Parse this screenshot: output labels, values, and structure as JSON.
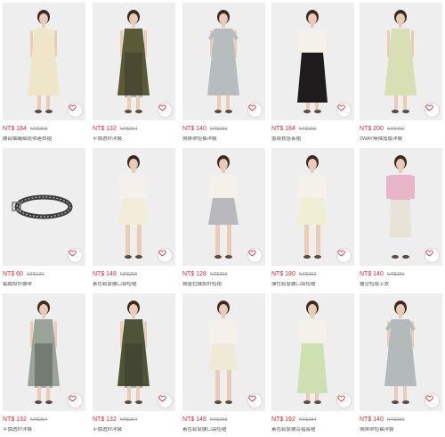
{
  "products": [
    {
      "price": "NT$ 184",
      "was": "NT$368",
      "name": "腰部抽繩細肩帶連衣裙",
      "garment": "dress",
      "color": "#efe6c8",
      "skin": "#e9cbb6"
    },
    {
      "price": "NT$ 132",
      "was": "NT$264",
      "name": "平價透紗洋裝",
      "garment": "layered",
      "color": "#5a5a36",
      "skin": "#e9cbb6"
    },
    {
      "price": "NT$ 140",
      "was": "NT$280",
      "name": "側綁帶短袖洋裝",
      "garment": "tee-dress",
      "color": "#b7bcbf",
      "skin": "#e9cbb6"
    },
    {
      "price": "NT$ 184",
      "was": "NT$368",
      "name": "蕾絲質感長裙",
      "garment": "skirt-long",
      "color": "#1e1c1c",
      "skin": "#e9cbb6"
    },
    {
      "price": "NT$ 200",
      "was": "NT$400",
      "name": "2WAY無袖寬版洋裝",
      "garment": "dress",
      "color": "#d9dfb4",
      "skin": "#e9cbb6"
    },
    {
      "price": "NT$ 60",
      "was": "NT$120",
      "name": "編織設計腰帶",
      "garment": "belt",
      "color": "#2a2a2a",
      "skin": "#e9cbb6"
    },
    {
      "price": "NT$ 148",
      "was": "NT$296",
      "name": "素色鬆緊腰口袋短裙",
      "garment": "skirt-short",
      "color": "#f1edd8",
      "skin": "#e9cbb6"
    },
    {
      "price": "NT$ 128",
      "was": "NT$256",
      "name": "側邊拉鍊設計短裙",
      "garment": "skirt-short",
      "color": "#b9b8bd",
      "skin": "#e9cbb6"
    },
    {
      "price": "NT$ 180",
      "was": "NT$360",
      "name": "彈性鬆緊腰口袋短裙",
      "garment": "skirt-short",
      "color": "#f0efd4",
      "skin": "#e9cbb6"
    },
    {
      "price": "NT$ 140",
      "was": "NT$280",
      "name": "鏤空短版上衣",
      "garment": "top",
      "color": "#e8b4c8",
      "skin": "#e9cbb6"
    },
    {
      "price": "NT$ 132",
      "was": "NT$264",
      "name": "平價透紗洋裝",
      "garment": "layered",
      "color": "#9aa39a",
      "skin": "#e9cbb6"
    },
    {
      "price": "NT$ 132",
      "was": "NT$264",
      "name": "平價透紗洋裝",
      "garment": "layered",
      "color": "#4e5436",
      "skin": "#e9cbb6"
    },
    {
      "price": "NT$ 148",
      "was": "NT$296",
      "name": "素色鬆緊腰口袋短裙",
      "garment": "skirt-short",
      "color": "#eeead6",
      "skin": "#e9cbb6"
    },
    {
      "price": "NT$ 192",
      "was": "NT$384",
      "name": "素色鬆緊腰百褶長裙",
      "garment": "skirt-long",
      "color": "#cfe0b0",
      "skin": "#e9cbb6"
    },
    {
      "price": "NT$ 140",
      "was": "NT$280",
      "name": "側綁帶短袖洋裝",
      "garment": "tee-dress",
      "color": "#b4b9bc",
      "skin": "#e9cbb6"
    }
  ],
  "icons": {
    "favorite": "heart-icon"
  },
  "colors": {
    "price": "#d0283a",
    "heart": "#d0283a"
  }
}
